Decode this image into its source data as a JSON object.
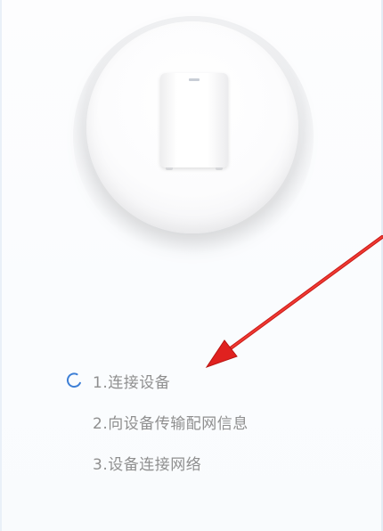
{
  "colors": {
    "step_text": "#8f8f8f",
    "spinner": "#3d7fd6",
    "arrow": "#e0211f"
  },
  "steps": [
    {
      "label": "1.连接设备",
      "status": "in-progress",
      "icon": "loading-spinner-icon"
    },
    {
      "label": "2.向设备传输配网信息",
      "status": "pending"
    },
    {
      "label": "3.设备连接网络",
      "status": "pending"
    }
  ]
}
